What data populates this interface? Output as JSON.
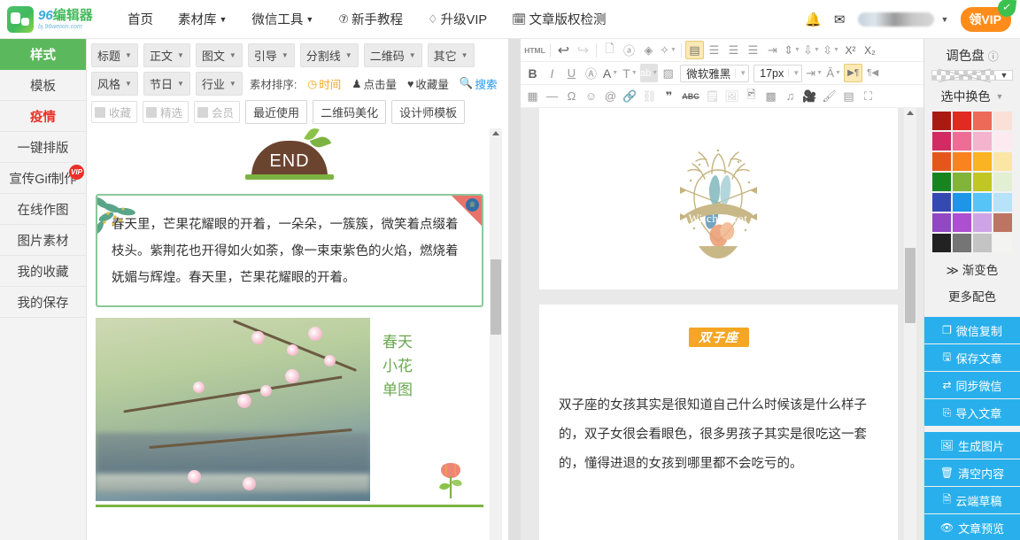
{
  "header": {
    "logo_main_num": "96",
    "logo_main_cn": "编辑器",
    "logo_sub": "bj.96weixin.com",
    "nav": [
      {
        "label": "首页",
        "caret": false,
        "icon": ""
      },
      {
        "label": "素材库",
        "caret": true,
        "icon": ""
      },
      {
        "label": "微信工具",
        "caret": true,
        "icon": ""
      },
      {
        "label": "新手教程",
        "caret": false,
        "icon": "⑦"
      },
      {
        "label": "升级VIP",
        "caret": false,
        "icon": "♢"
      },
      {
        "label": "文章版权检测",
        "caret": false,
        "icon": "📅"
      }
    ],
    "bell_icon": "🔔",
    "mail_icon": "✉",
    "vip_button": "VIP",
    "vip_prefix": "领",
    "vip_leaf": "✓"
  },
  "sidebar": {
    "items": [
      {
        "label": "样式",
        "state": "active"
      },
      {
        "label": "模板",
        "state": "normal"
      },
      {
        "label": "疫情",
        "state": "hot"
      },
      {
        "label": "一键排版",
        "state": "normal"
      },
      {
        "label": "宣传Gif制作",
        "state": "normal",
        "badge": "VIP"
      },
      {
        "label": "在线作图",
        "state": "normal"
      },
      {
        "label": "图片素材",
        "state": "normal"
      },
      {
        "label": "我的收藏",
        "state": "normal"
      },
      {
        "label": "我的保存",
        "state": "normal"
      }
    ]
  },
  "filters": {
    "row1": [
      "标题",
      "正文",
      "图文",
      "引导",
      "分割线",
      "二维码",
      "其它"
    ],
    "row2_dropdowns": [
      "风格",
      "节日",
      "行业"
    ],
    "sort_label": "素材排序:",
    "sort_options": [
      {
        "label": "时间",
        "icon": "◷",
        "active": true
      },
      {
        "label": "点击量",
        "icon": "♟",
        "active": false
      },
      {
        "label": "收藏量",
        "icon": "♥",
        "active": false
      },
      {
        "label": "搜索",
        "icon": "🔍",
        "active": false,
        "search": true
      }
    ],
    "checkboxes": [
      "收藏",
      "精选",
      "会员"
    ],
    "buttons": [
      "最近使用",
      "二维码美化",
      "设计师模板"
    ]
  },
  "material": {
    "end_card": {
      "label": "END"
    },
    "text_card": {
      "body": "春天里，芒果花耀眼的开着，一朵朵，一簇簇，微笑着点缀着枝头。紫荆花也开得如火如荼，像一束束紫色的火焰，燃烧着妩媚与辉煌。春天里，芒果花耀眼的开着。",
      "crown_icon": "♕"
    },
    "photo_card": {
      "lines": [
        "春天",
        "小花",
        "单图"
      ]
    }
  },
  "toolbar": {
    "row1": [
      {
        "name": "html-button",
        "glyph": "HTML",
        "type": "lbl"
      },
      {
        "name": "sep",
        "type": "sep"
      },
      {
        "name": "undo-icon",
        "glyph": "↶",
        "type": "dark"
      },
      {
        "name": "redo-icon",
        "glyph": "↷",
        "type": "off"
      },
      {
        "name": "sep",
        "type": "sep"
      },
      {
        "name": "new-document-icon",
        "glyph": "🗋",
        "type": "i"
      },
      {
        "name": "select-all-icon",
        "glyph": "ⓐ",
        "type": "i"
      },
      {
        "name": "eraser-icon",
        "glyph": "◇",
        "type": "i"
      },
      {
        "name": "format-brush-icon",
        "glyph": "✎",
        "type": "i",
        "caret": true
      },
      {
        "name": "sep",
        "type": "sep"
      },
      {
        "name": "align-left-icon",
        "glyph": "▤",
        "type": "sel"
      },
      {
        "name": "align-center-icon",
        "glyph": "☰",
        "type": "i"
      },
      {
        "name": "align-right-icon",
        "glyph": "☰",
        "type": "i"
      },
      {
        "name": "align-justify-icon",
        "glyph": "☰",
        "type": "i"
      },
      {
        "name": "indent-icon",
        "glyph": "⇥",
        "type": "i"
      },
      {
        "name": "line-height-icon",
        "glyph": "↕",
        "type": "i",
        "caret": true
      },
      {
        "name": "paragraph-spacing-icon",
        "glyph": "⇅",
        "type": "i",
        "caret": true
      },
      {
        "name": "letter-spacing-icon",
        "glyph": "↔",
        "type": "i",
        "caret": true
      },
      {
        "name": "superscript-icon",
        "glyph": "X²",
        "type": "dark"
      },
      {
        "name": "subscript-icon",
        "glyph": "X₂",
        "type": "dark"
      }
    ],
    "row2": [
      {
        "name": "bold-icon",
        "glyph": "B",
        "type": "dark"
      },
      {
        "name": "italic-icon",
        "glyph": "I",
        "type": "i"
      },
      {
        "name": "underline-icon",
        "glyph": "U",
        "type": "i"
      },
      {
        "name": "text-border-icon",
        "glyph": "Ⓐ",
        "type": "i"
      },
      {
        "name": "font-color-icon",
        "glyph": "A",
        "type": "dark",
        "caret": true
      },
      {
        "name": "text-shadow-icon",
        "glyph": "T",
        "type": "i",
        "caret": true
      },
      {
        "name": "highlight-icon",
        "glyph": "ab",
        "type": "i",
        "caret": true
      },
      {
        "name": "background-image-icon",
        "glyph": "▨",
        "type": "i",
        "caret": true
      }
    ],
    "font_family": "微软雅黑",
    "font_size": "17px",
    "row2_tail": [
      {
        "name": "indent-text-icon",
        "glyph": "⇥",
        "type": "i",
        "caret": true
      },
      {
        "name": "font-scale-icon",
        "glyph": "A",
        "type": "i",
        "caret": true
      },
      {
        "name": "ltr-direction-icon",
        "glyph": "▶¶",
        "type": "sel"
      },
      {
        "name": "rtl-direction-icon",
        "glyph": "¶◀",
        "type": "i"
      }
    ],
    "row3": [
      {
        "name": "table-icon",
        "glyph": "▦"
      },
      {
        "name": "horizontal-rule-icon",
        "glyph": "—"
      },
      {
        "name": "special-character-icon",
        "glyph": "Ω"
      },
      {
        "name": "emoji-icon",
        "glyph": "☺"
      },
      {
        "name": "at-mention-icon",
        "glyph": "@"
      },
      {
        "name": "link-icon",
        "glyph": "🔗"
      },
      {
        "name": "unlink-icon",
        "glyph": "⛓",
        "off": true
      },
      {
        "name": "quote-icon",
        "glyph": "❞"
      },
      {
        "name": "strikethrough-icon",
        "glyph": "ABC"
      },
      {
        "name": "article-card-icon",
        "glyph": "🗒",
        "off": true
      },
      {
        "name": "insert-image-icon",
        "glyph": "🖼",
        "off": true
      },
      {
        "name": "multi-image-icon",
        "glyph": "🖻"
      },
      {
        "name": "qrcode-icon",
        "glyph": "▩"
      },
      {
        "name": "music-icon",
        "glyph": "♫"
      },
      {
        "name": "video-icon",
        "glyph": "🎥"
      },
      {
        "name": "clear-format-icon",
        "glyph": "🖌"
      },
      {
        "name": "slide-icon",
        "glyph": "▤"
      },
      {
        "name": "fullscreen-icon",
        "glyph": "⛶"
      }
    ]
  },
  "editor": {
    "tarot_logo_text": "Witch Tarot",
    "zodiac_badge": "双子座",
    "zodiac_text": "双子座的女孩其实是很知道自己什么时候该是什么样子的，双子女很会看眼色，很多男孩子其实是很吃这一套的，懂得进退的女孩到哪里都不会吃亏的。"
  },
  "right_panel": {
    "title": "调色盘",
    "help_icon": "?",
    "current_swatch_caret": "▼",
    "mode_label": "选中换色",
    "mode_caret": "▼",
    "palette": [
      [
        "#a81b10",
        "#e02a22",
        "#ec6a58",
        "#fae0d6"
      ],
      [
        "#d22a63",
        "#ee6d96",
        "#f4b4ce",
        "#fdeaf1"
      ],
      [
        "#e3581a",
        "#f9831f",
        "#fbb321",
        "#fce6a6"
      ],
      [
        "#16851f",
        "#82b43a",
        "#c1c722",
        "#e2efd2"
      ],
      [
        "#3549b2",
        "#1f95e8",
        "#57c4f7",
        "#b8e2fa"
      ],
      [
        "#9148c2",
        "#ac4fd0",
        "#cfa4e6",
        "#bc7463"
      ],
      [
        "#222222",
        "#757575",
        "#c4c4c4",
        "#f3f3f1"
      ]
    ],
    "gradient_link": "渐变色",
    "gradient_icon": "≫",
    "more_colors_link": "更多配色",
    "actions_group1": [
      {
        "label": "微信复制",
        "icon": "❐"
      },
      {
        "label": "保存文章",
        "icon": "🖫"
      },
      {
        "label": "同步微信",
        "icon": "⇄"
      },
      {
        "label": "导入文章",
        "icon": "⎘"
      }
    ],
    "actions_group2": [
      {
        "label": "生成图片",
        "icon": "🖼"
      },
      {
        "label": "清空内容",
        "icon": "🗑"
      },
      {
        "label": "云端草稿",
        "icon": "🗎"
      },
      {
        "label": "文章预览",
        "icon": "👁"
      }
    ]
  }
}
